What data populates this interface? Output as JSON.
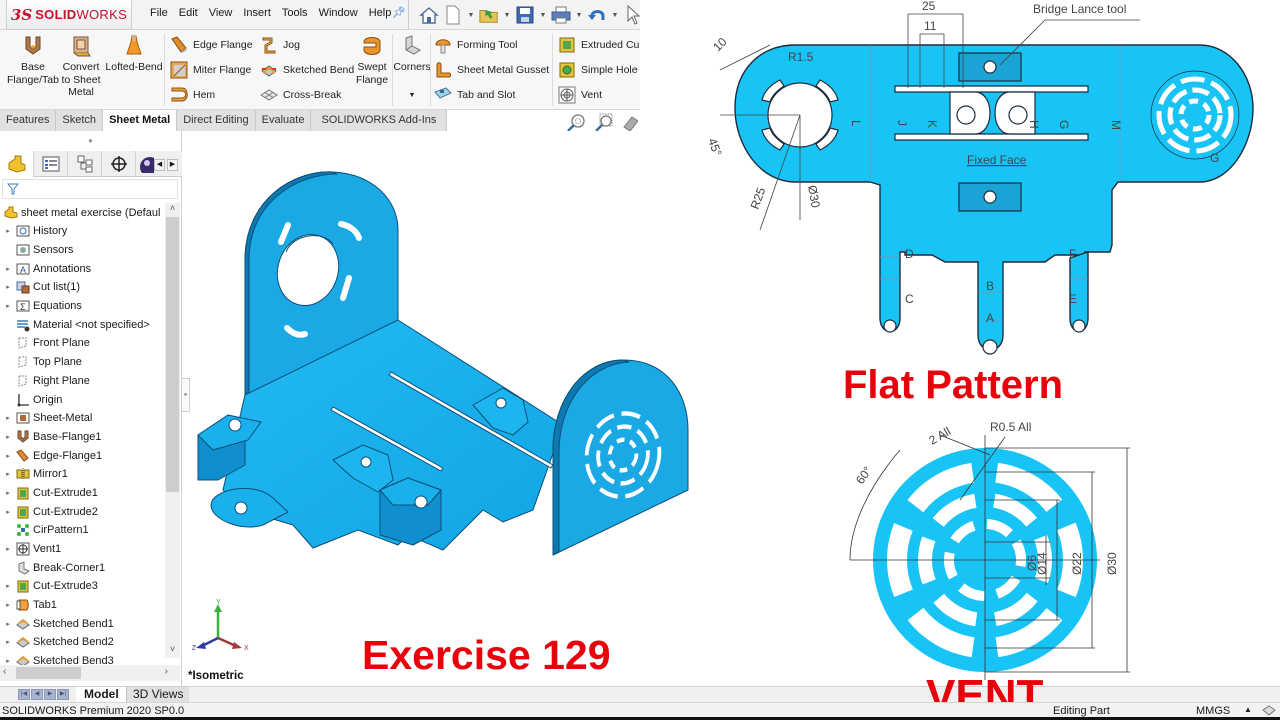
{
  "app": {
    "logo_prefix": "3S",
    "logo_bold": "SOLID",
    "logo_light": "WORKS",
    "menus": [
      "File",
      "Edit",
      "View",
      "Insert",
      "Tools",
      "Window",
      "Help"
    ],
    "quick_access": [
      "home-icon",
      "new-document-icon",
      "open-icon",
      "save-icon",
      "print-icon",
      "undo-icon",
      "select-cursor-icon"
    ]
  },
  "command_manager": {
    "big_buttons": [
      {
        "label": "Base Flange/Tab",
        "line1": "Base",
        "line2": "Flange/Tab",
        "icon": "base-flange-icon"
      },
      {
        "label": "Convert to Sheet Metal",
        "line1": "Convert",
        "line2": "to Sheet",
        "line3": "Metal",
        "icon": "convert-sheet-metal-icon"
      },
      {
        "label": "Lofted-Bend",
        "line1": "Lofted-Bend",
        "icon": "lofted-bend-icon"
      },
      {
        "label": "Swept Flange",
        "line1": "Swept",
        "line2": "Flange",
        "icon": "swept-flange-icon"
      },
      {
        "label": "Corners",
        "line1": "Corners",
        "icon": "corners-icon"
      }
    ],
    "small_buttons": [
      {
        "label": "Edge Flange",
        "icon": "edge-flange-icon"
      },
      {
        "label": "Miter Flange",
        "icon": "miter-flange-icon"
      },
      {
        "label": "Hem",
        "icon": "hem-icon"
      },
      {
        "label": "Jog",
        "icon": "jog-icon"
      },
      {
        "label": "Sketched Bend",
        "icon": "sketched-bend-icon"
      },
      {
        "label": "Cross-Break",
        "icon": "cross-break-icon"
      },
      {
        "label": "Forming Tool",
        "icon": "forming-tool-icon"
      },
      {
        "label": "Sheet Metal Gusset",
        "icon": "gusset-icon"
      },
      {
        "label": "Tab and Slot",
        "icon": "tab-slot-icon"
      },
      {
        "label": "Extruded Cu",
        "icon": "extruded-cut-icon"
      },
      {
        "label": "Simple Hole",
        "icon": "simple-hole-icon"
      },
      {
        "label": "Vent",
        "icon": "vent-icon"
      }
    ]
  },
  "tabs": [
    {
      "label": "Features",
      "active": false
    },
    {
      "label": "Sketch",
      "active": false
    },
    {
      "label": "Sheet Metal",
      "active": true
    },
    {
      "label": "Direct Editing",
      "active": false
    },
    {
      "label": "Evaluate",
      "active": false
    },
    {
      "label": "SOLIDWORKS Add-Ins",
      "active": false
    }
  ],
  "feature_tree": {
    "root": "sheet metal exercise  (Defaul",
    "items": [
      {
        "label": "History",
        "expandable": true,
        "icon": "history-icon"
      },
      {
        "label": "Sensors",
        "expandable": false,
        "icon": "sensors-icon"
      },
      {
        "label": "Annotations",
        "expandable": true,
        "icon": "annotations-icon"
      },
      {
        "label": "Cut list(1)",
        "expandable": true,
        "icon": "cut-list-icon"
      },
      {
        "label": "Equations",
        "expandable": true,
        "icon": "equations-icon"
      },
      {
        "label": "Material <not specified>",
        "expandable": false,
        "icon": "material-icon"
      },
      {
        "label": "Front Plane",
        "expandable": false,
        "icon": "plane-icon"
      },
      {
        "label": "Top Plane",
        "expandable": false,
        "icon": "plane-icon"
      },
      {
        "label": "Right Plane",
        "expandable": false,
        "icon": "plane-icon"
      },
      {
        "label": "Origin",
        "expandable": false,
        "icon": "origin-icon"
      },
      {
        "label": "Sheet-Metal",
        "expandable": true,
        "icon": "sheet-metal-icon"
      },
      {
        "label": "Base-Flange1",
        "expandable": true,
        "icon": "base-flange-icon"
      },
      {
        "label": "Edge-Flange1",
        "expandable": true,
        "icon": "edge-flange-icon"
      },
      {
        "label": "Mirror1",
        "expandable": true,
        "icon": "mirror-icon"
      },
      {
        "label": "Cut-Extrude1",
        "expandable": true,
        "icon": "cut-extrude-icon"
      },
      {
        "label": "Cut-Extrude2",
        "expandable": true,
        "icon": "cut-extrude-icon"
      },
      {
        "label": "CirPattern1",
        "expandable": false,
        "icon": "circular-pattern-icon"
      },
      {
        "label": "Vent1",
        "expandable": true,
        "icon": "vent-icon"
      },
      {
        "label": "Break-Corner1",
        "expandable": false,
        "icon": "break-corner-icon"
      },
      {
        "label": "Cut-Extrude3",
        "expandable": true,
        "icon": "cut-extrude-icon"
      },
      {
        "label": "Tab1",
        "expandable": true,
        "icon": "tab-icon"
      },
      {
        "label": "Sketched Bend1",
        "expandable": true,
        "icon": "sketched-bend-icon"
      },
      {
        "label": "Sketched Bend2",
        "expandable": true,
        "icon": "sketched-bend-icon"
      },
      {
        "label": "Sketched Bend3",
        "expandable": true,
        "icon": "sketched-bend-icon"
      }
    ]
  },
  "graphics": {
    "view_name": "*Isometric",
    "triad": {
      "x": "X",
      "y": "Y",
      "z": "Z"
    },
    "exercise_label": "Exercise 129",
    "model_color": "#1ab0ec"
  },
  "flat_pattern": {
    "title": "Flat Pattern",
    "callout": "Bridge Lance tool",
    "fixed_face": "Fixed Face",
    "dims": {
      "d25": "25",
      "d11": "11",
      "d10": "10",
      "r15": "R1.5",
      "a45": "45°",
      "r25": "R25",
      "dia30": "Ø30"
    },
    "bend_letters": [
      "L",
      "J",
      "K",
      "H",
      "G",
      "M",
      "D",
      "F",
      "C",
      "E",
      "B",
      "A"
    ],
    "vent_letter": "G"
  },
  "vent_detail": {
    "title": "VENT",
    "dims": {
      "rib": "2 All",
      "fillet": "R0.5 All",
      "angle": "60°",
      "d6": "Ø6",
      "d14": "Ø14",
      "d22": "Ø22",
      "d30": "Ø30"
    }
  },
  "bottom_tabs": [
    {
      "label": "Model",
      "active": true
    },
    {
      "label": "3D Views",
      "active": false
    }
  ],
  "status": {
    "product": "SOLIDWORKS Premium 2020 SP0.0",
    "mode": "Editing Part",
    "units": "MMGS",
    "caret": "▲"
  },
  "colors": {
    "brand_red": "#c8102e",
    "label_red": "#e8000b",
    "part_blue": "#1ab0ec",
    "flat_blue": "#18c4f5"
  }
}
